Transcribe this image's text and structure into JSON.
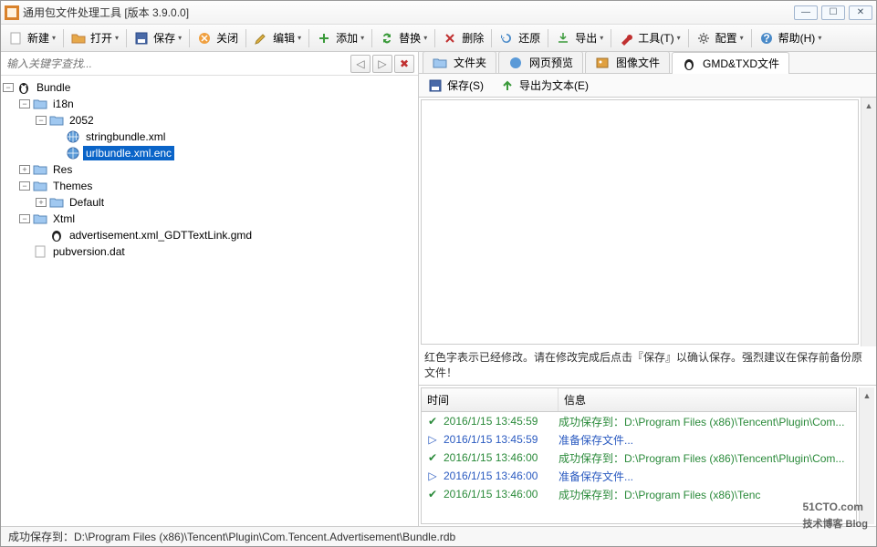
{
  "window": {
    "title": "通用包文件处理工具 [版本 3.9.0.0]"
  },
  "toolbar": {
    "new": "新建",
    "open": "打开",
    "save": "保存",
    "close": "关闭",
    "edit": "编辑",
    "add": "添加",
    "replace": "替换",
    "delete": "删除",
    "restore": "还原",
    "export": "导出",
    "tools": "工具(T)",
    "config": "配置",
    "help": "帮助(H)"
  },
  "search": {
    "placeholder": "输入关键字查找..."
  },
  "tree": {
    "root": "Bundle",
    "i18n": "i18n",
    "loc": "2052",
    "f1": "stringbundle.xml",
    "f2": "urlbundle.xml.enc",
    "res": "Res",
    "themes": "Themes",
    "default": "Default",
    "xtml": "Xtml",
    "adv": "advertisement.xml_GDTTextLink.gmd",
    "pub": "pubversion.dat"
  },
  "tabs": {
    "folder": "文件夹",
    "web": "网页预览",
    "image": "图像文件",
    "gmd": "GMD&TXD文件"
  },
  "subtoolbar": {
    "save": "保存(S)",
    "export_text": "导出为文本(E)"
  },
  "editor_hint": "红色字表示已经修改。请在修改完成后点击『保存』以确认保存。强烈建议在保存前备份原文件！",
  "log": {
    "col_time": "时间",
    "col_msg": "信息",
    "rows": [
      {
        "type": "ok",
        "time": "2016/1/15 13:45:59",
        "msg": "成功保存到：D:\\Program Files (x86)\\Tencent\\Plugin\\Com..."
      },
      {
        "type": "info",
        "time": "2016/1/15 13:45:59",
        "msg": "准备保存文件..."
      },
      {
        "type": "ok",
        "time": "2016/1/15 13:46:00",
        "msg": "成功保存到：D:\\Program Files (x86)\\Tencent\\Plugin\\Com..."
      },
      {
        "type": "info",
        "time": "2016/1/15 13:46:00",
        "msg": "准备保存文件..."
      },
      {
        "type": "ok",
        "time": "2016/1/15 13:46:00",
        "msg": "成功保存到：D:\\Program Files (x86)\\Tenc"
      }
    ]
  },
  "statusbar": "成功保存到：D:\\Program Files (x86)\\Tencent\\Plugin\\Com.Tencent.Advertisement\\Bundle.rdb",
  "watermark": {
    "main": "51CTO.com",
    "sub": "技术博客 Blog"
  }
}
